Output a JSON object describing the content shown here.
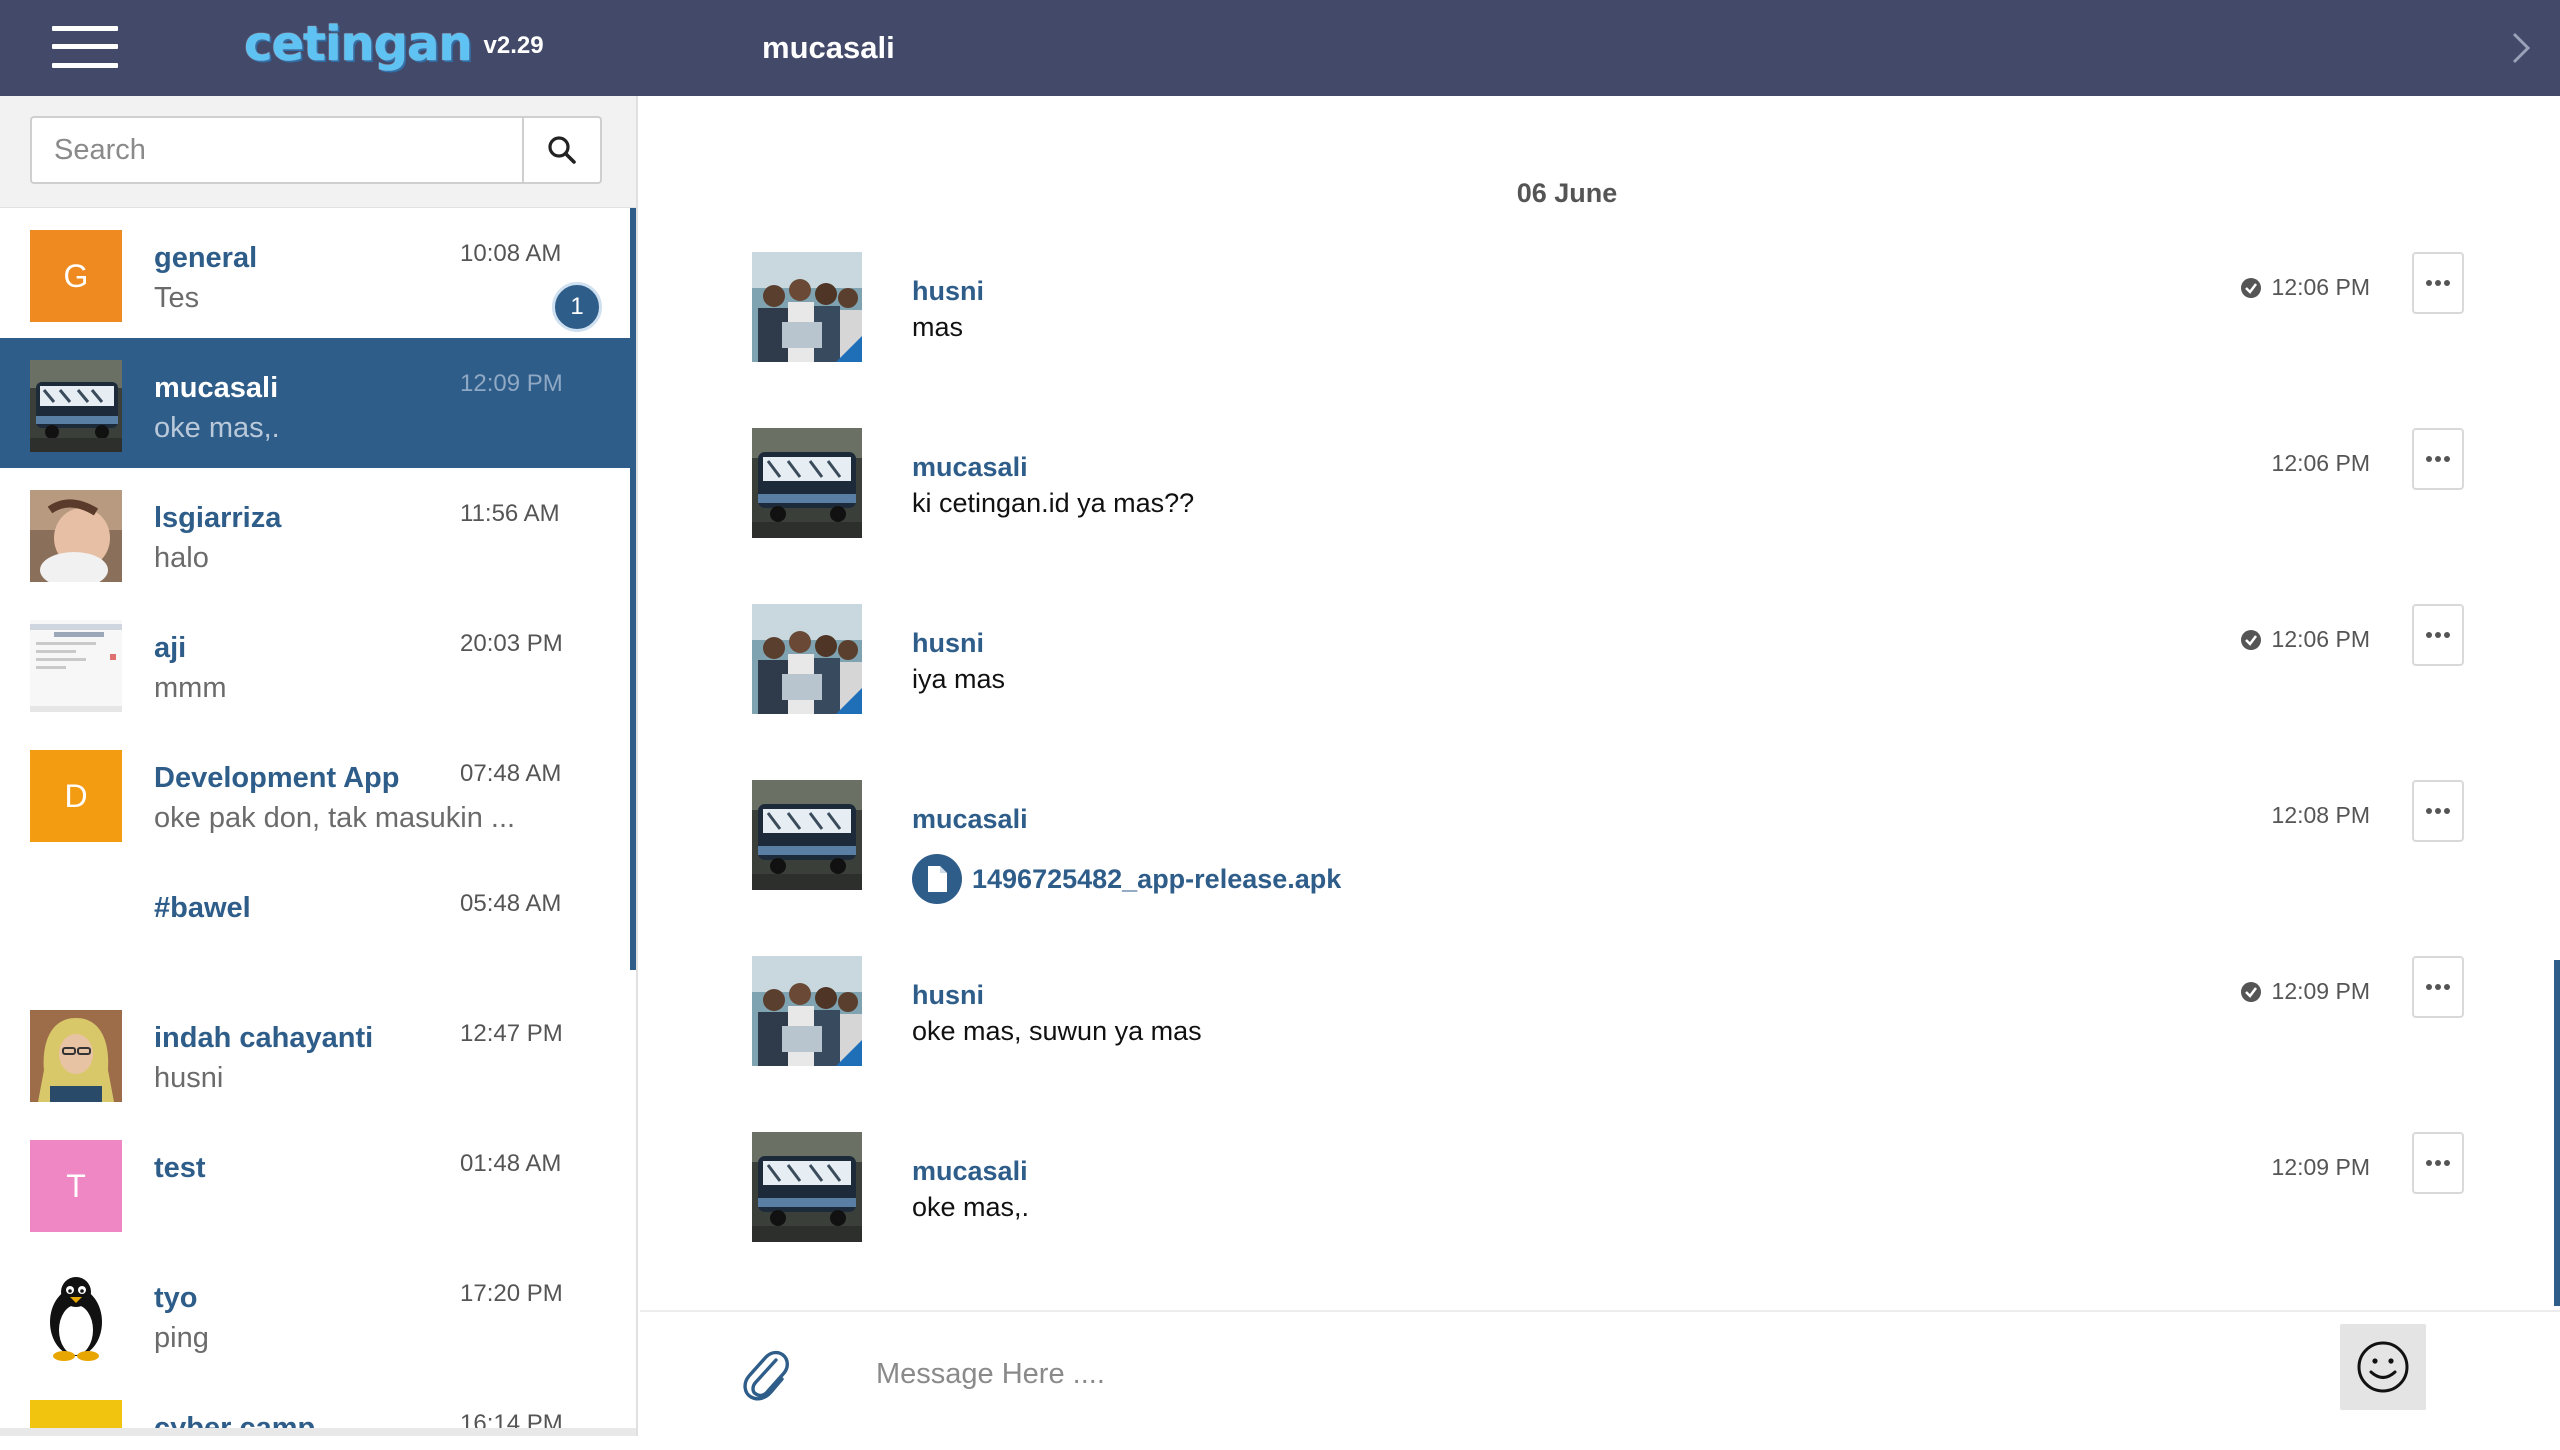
{
  "app": {
    "logo_text": "cetingan",
    "version": "v2.29"
  },
  "header": {
    "title": "mucasali",
    "menu_icon": "hamburger-menu-icon",
    "collapse_icon": "chevron-right-icon"
  },
  "search": {
    "placeholder": "Search",
    "value": "",
    "icon": "search-icon"
  },
  "colors": {
    "header_bg": "#434969",
    "accent": "#2e5d8a",
    "logo": "#5ec2f2"
  },
  "conversations": [
    {
      "name": "general",
      "preview": "Tes",
      "time": "10:08 AM",
      "avatar_letter": "G",
      "avatar_color": "#ee8a1f",
      "unread": "1",
      "active": false
    },
    {
      "name": "mucasali",
      "preview": "oke mas,.",
      "time": "12:09 PM",
      "avatar": "bus-photo",
      "active": true
    },
    {
      "name": "lsgiarriza",
      "preview": "halo",
      "time": "11:56 AM",
      "avatar": "person-photo",
      "active": false
    },
    {
      "name": "aji",
      "preview": "mmm",
      "time": "20:03 PM",
      "avatar": "screenshot-thumbnail",
      "active": false
    },
    {
      "name": "Development App",
      "preview": "oke pak don, tak masukin ...",
      "time": "07:48 AM",
      "avatar_letter": "D",
      "avatar_color": "#f39c12",
      "active": false
    },
    {
      "name": "#bawel",
      "preview": "",
      "time": "05:48 AM",
      "active": false
    },
    {
      "name": "indah cahayanti",
      "preview": "husni",
      "time": "12:47 PM",
      "avatar": "hijab-person-photo",
      "active": false
    },
    {
      "name": "test",
      "preview": "",
      "time": "01:48 AM",
      "avatar_letter": "T",
      "avatar_color": "#ef87c4",
      "active": false
    },
    {
      "name": "tyo",
      "preview": "ping",
      "time": "17:20 PM",
      "avatar": "penguin-icon",
      "active": false
    },
    {
      "name": "cyber camp",
      "preview": "",
      "time": "16:14 PM",
      "avatar_color": "#f1c40f",
      "active": false
    }
  ],
  "chat": {
    "date_separator": "06 June",
    "messages": [
      {
        "sender": "husni",
        "text": "mas",
        "time": "12:06 PM",
        "read": true,
        "avatar": "group-photo"
      },
      {
        "sender": "mucasali",
        "text": "ki cetingan.id ya mas??",
        "time": "12:06 PM",
        "read": false,
        "avatar": "bus-photo"
      },
      {
        "sender": "husni",
        "text": "iya mas",
        "time": "12:06 PM",
        "read": true,
        "avatar": "group-photo"
      },
      {
        "sender": "mucasali",
        "file": "1496725482_app-release.apk",
        "time": "12:08 PM",
        "read": false,
        "avatar": "bus-photo"
      },
      {
        "sender": "husni",
        "text": "oke mas, suwun ya mas",
        "time": "12:09 PM",
        "read": true,
        "avatar": "group-photo"
      },
      {
        "sender": "mucasali",
        "text": "oke mas,.",
        "time": "12:09 PM",
        "read": false,
        "avatar": "bus-photo"
      }
    ]
  },
  "composer": {
    "placeholder": "Message Here ....",
    "value": "",
    "attach_icon": "paperclip-icon",
    "emoji_icon": "smiley-icon"
  }
}
